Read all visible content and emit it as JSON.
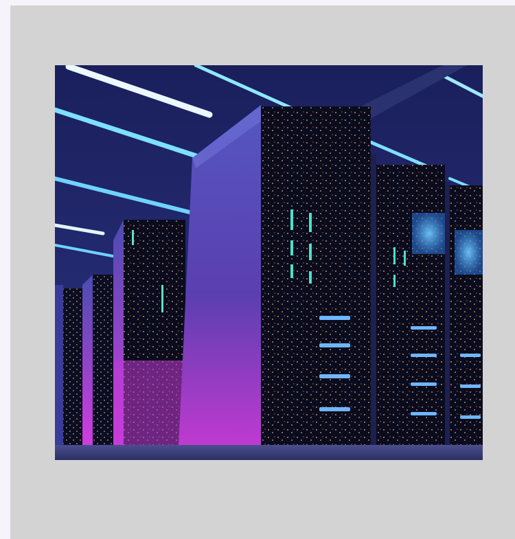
{
  "page": {
    "background_color": "#f7f3fa"
  },
  "card": {
    "background_color": "#d3d3d3"
  },
  "image": {
    "subject": "server-racks-photo",
    "alt": "",
    "colors": {
      "ceiling": "#1a2060",
      "light_cyan": "#9fe8ff",
      "rack_face": "#0a0d1f",
      "rack_side": "#3a3c9a",
      "magenta_glow": "#c13ad6",
      "blue_panel": "#3b9cf5",
      "floor": "#3a4078"
    }
  }
}
